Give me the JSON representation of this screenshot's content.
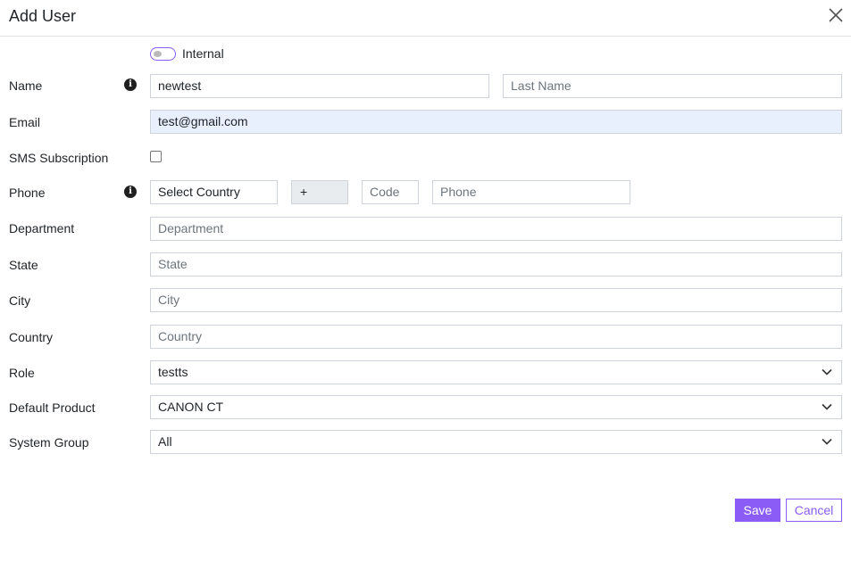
{
  "dialog": {
    "title": "Add User"
  },
  "toggle": {
    "label": "Internal"
  },
  "fields": {
    "name": {
      "label": "Name",
      "first_value": "newtest",
      "last_placeholder": "Last Name"
    },
    "email": {
      "label": "Email",
      "value": "test@gmail.com"
    },
    "sms": {
      "label": "SMS Subscription"
    },
    "phone": {
      "label": "Phone",
      "country_value": "Select Country",
      "prefix": "+",
      "code_placeholder": "Code",
      "phone_placeholder": "Phone"
    },
    "department": {
      "label": "Department",
      "placeholder": "Department"
    },
    "state": {
      "label": "State",
      "placeholder": "State"
    },
    "city": {
      "label": "City",
      "placeholder": "City"
    },
    "country": {
      "label": "Country",
      "placeholder": "Country"
    },
    "role": {
      "label": "Role",
      "value": "testts"
    },
    "default_product": {
      "label": "Default Product",
      "value": "CANON CT"
    },
    "system_group": {
      "label": "System Group",
      "value": "All"
    }
  },
  "actions": {
    "save": "Save",
    "cancel": "Cancel"
  },
  "colors": {
    "accent": "#8b5cf6",
    "autofill_bg": "#e8f0fe",
    "addon_bg": "#e9ecef"
  },
  "icons": {
    "close": "close-icon",
    "info": "info-icon",
    "caret": "chevron-down-icon"
  }
}
